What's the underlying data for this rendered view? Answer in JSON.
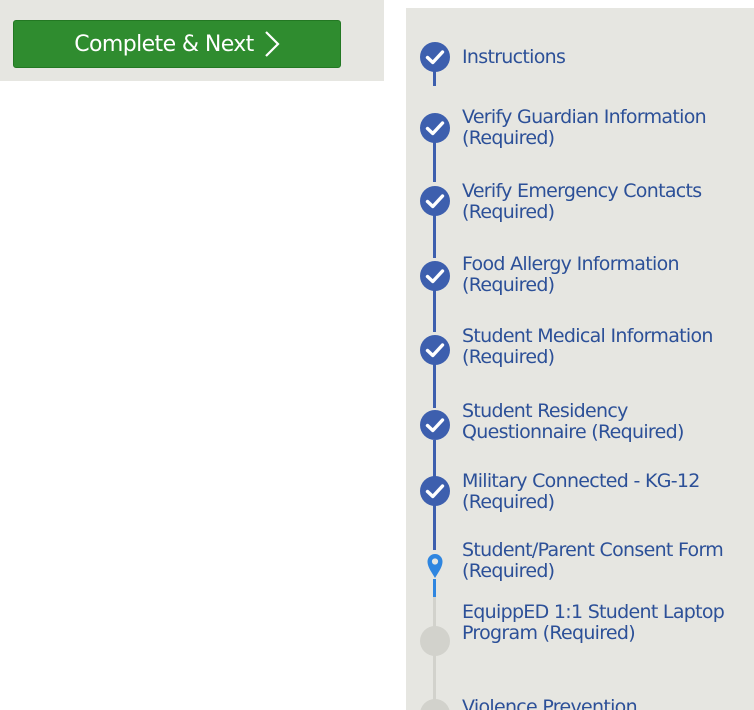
{
  "toolbar": {
    "complete_next_label": "Complete & Next",
    "chevron_icon": "chevron-right-icon"
  },
  "colors": {
    "button_green": "#2f8c2f",
    "step_done_blue": "#3d5fae",
    "step_current_blue": "#2f86e0",
    "step_pending_gray": "#d2d2cc",
    "label_blue": "#2c5098",
    "panel_bg": "#e6e6e1"
  },
  "steps": [
    {
      "label": "Instructions",
      "status": "complete",
      "icon": "check-circle-icon"
    },
    {
      "label": "Verify Guardian Information (Required)",
      "status": "complete",
      "icon": "check-circle-icon"
    },
    {
      "label": "Verify Emergency Contacts (Required)",
      "status": "complete",
      "icon": "check-circle-icon"
    },
    {
      "label": "Food Allergy Information (Required)",
      "status": "complete",
      "icon": "check-circle-icon"
    },
    {
      "label": "Student Medical Information (Required)",
      "status": "complete",
      "icon": "check-circle-icon"
    },
    {
      "label": "Student Residency Questionnaire (Required)",
      "status": "complete",
      "icon": "check-circle-icon"
    },
    {
      "label": "Military Connected - KG-12 (Required)",
      "status": "complete",
      "icon": "check-circle-icon"
    },
    {
      "label": "Student/Parent Consent Form (Required)",
      "status": "current",
      "icon": "location-pin-icon"
    },
    {
      "label": "EquippED 1:1 Student Laptop Program (Required)",
      "status": "pending",
      "icon": "empty-circle-icon"
    },
    {
      "label": "Violence Prevention",
      "status": "pending",
      "icon": "empty-circle-icon"
    }
  ]
}
